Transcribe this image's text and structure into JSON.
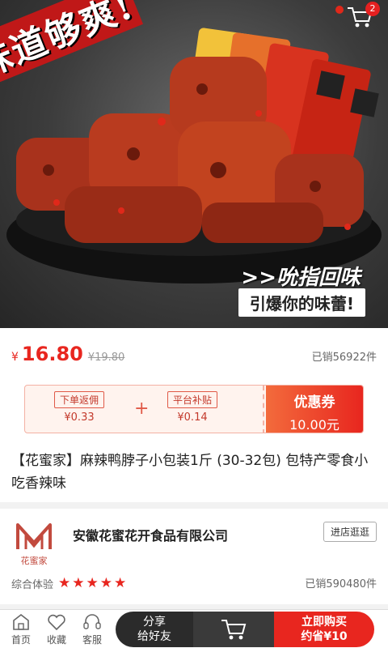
{
  "hero": {
    "slogan": "味道够爽!",
    "tagline_1": ">>吮指回味",
    "tagline_2": "引爆你的味蕾!",
    "cart_badge": "2"
  },
  "product": {
    "currency": "¥",
    "price": "16.80",
    "original_price": "¥19.80",
    "sold": "已销56922件",
    "title": "【花蜜家】麻辣鸭脖子小包装1斤 (30-32包) 包特产零食小吃香辣味"
  },
  "coupon": {
    "rebate_label": "下单返佣",
    "rebate_value": "¥0.33",
    "plus": "+",
    "subsidy_label": "平台补贴",
    "subsidy_value": "¥0.14",
    "coupon_label": "优惠券",
    "coupon_value": "10.00元"
  },
  "shop": {
    "logo_text": "花蜜家",
    "name": "安徽花蜜花开食品有限公司",
    "visit_label": "进店逛逛",
    "rating_label": "综合体验",
    "stars": 5,
    "stars_text": "★★★★★",
    "sold": "已销590480件"
  },
  "bottom": {
    "home": "首页",
    "favorite": "收藏",
    "service": "客服",
    "share_line1": "分享",
    "share_line2": "给好友",
    "buy_line1": "立即购买",
    "buy_line2": "约省¥10"
  },
  "colors": {
    "accent": "#e8261f",
    "dark": "#2b2b2b"
  }
}
